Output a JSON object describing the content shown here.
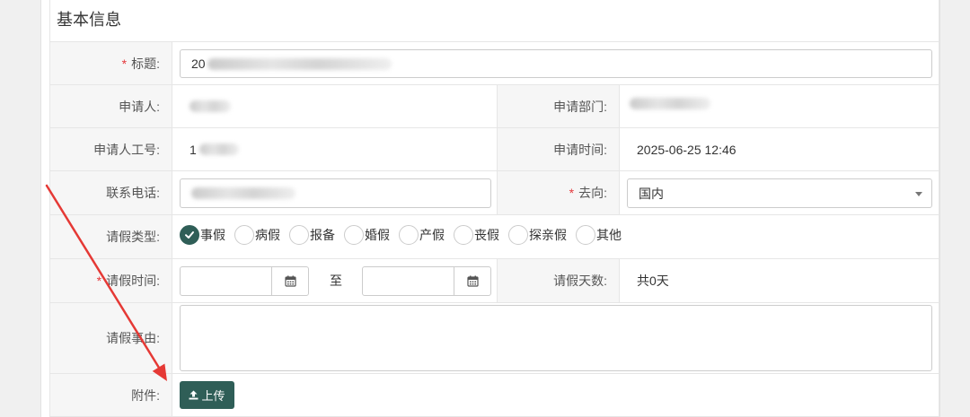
{
  "section": {
    "title": "基本信息"
  },
  "required_mark": "*",
  "fields": {
    "title": {
      "label": "标题:",
      "value": "20"
    },
    "applicant": {
      "label": "申请人:"
    },
    "department": {
      "label": "申请部门:"
    },
    "employee_id": {
      "label": "申请人工号:",
      "value": "1"
    },
    "apply_time": {
      "label": "申请时间:",
      "value": "2025-06-25 12:46"
    },
    "phone": {
      "label": "联系电话:"
    },
    "destination": {
      "label": "去向:",
      "value": "国内"
    },
    "leave_type": {
      "label": "请假类型:",
      "options": [
        "事假",
        "病假",
        "报备",
        "婚假",
        "产假",
        "丧假",
        "探亲假",
        "其他"
      ],
      "selected_index": 0
    },
    "leave_time": {
      "label": "请假时间:",
      "separator": "至"
    },
    "leave_days": {
      "label": "请假天数:",
      "value": "共0天"
    },
    "reason": {
      "label": "请假事由:"
    },
    "attachment": {
      "label": "附件:",
      "button_label": "上传"
    }
  },
  "icons": {
    "calendar": "calendar-icon",
    "upload": "upload-icon",
    "dropdown": "chevron-down-icon",
    "check": "check-icon",
    "annotation": "red-arrow-annotation"
  },
  "colors": {
    "accent": "#2f5e57",
    "required": "#e4393c",
    "annotation": "#e53935"
  }
}
